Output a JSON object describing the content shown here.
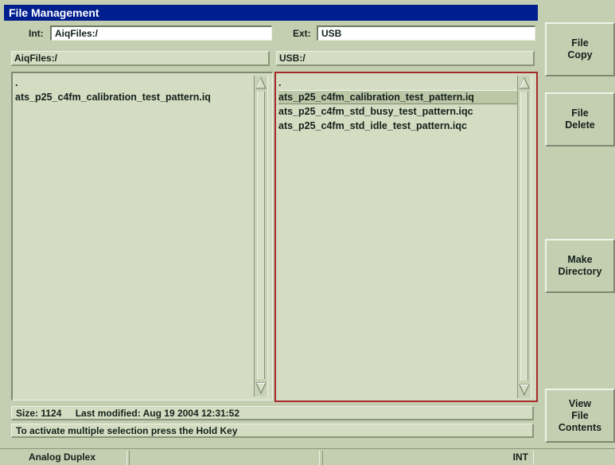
{
  "window": {
    "title": "File Management"
  },
  "header": {
    "int_label": "Int:",
    "int_value": "AiqFiles:/",
    "ext_label": "Ext:",
    "ext_value": "USB"
  },
  "left_panel": {
    "path": "AiqFiles:/",
    "items": [
      ".",
      "ats_p25_c4fm_calibration_test_pattern.iq"
    ]
  },
  "right_panel": {
    "path": "USB:/",
    "items": [
      ".",
      "ats_p25_c4fm_calibration_test_pattern.iq",
      "ats_p25_c4fm_std_busy_test_pattern.iqc",
      "ats_p25_c4fm_std_idle_test_pattern.iqc"
    ],
    "selected_index": 1
  },
  "status": {
    "size": "Size: 1124",
    "modified": "Last modified: Aug 19 2004 12:31:52",
    "hint": "To activate multiple selection press the Hold Key"
  },
  "softkeys": {
    "file_copy": "File\nCopy",
    "file_delete": "File\nDelete",
    "make_directory": "Make\nDirectory",
    "view_contents": "View\nFile\nContents"
  },
  "bottom_bar": {
    "mode": "Analog Duplex",
    "source": "INT"
  },
  "colors": {
    "title_bg": "#001f8e",
    "panel_bg": "#d4dcc2",
    "frame_bg": "#c4cfb2",
    "focus_border": "#a72a2a"
  }
}
